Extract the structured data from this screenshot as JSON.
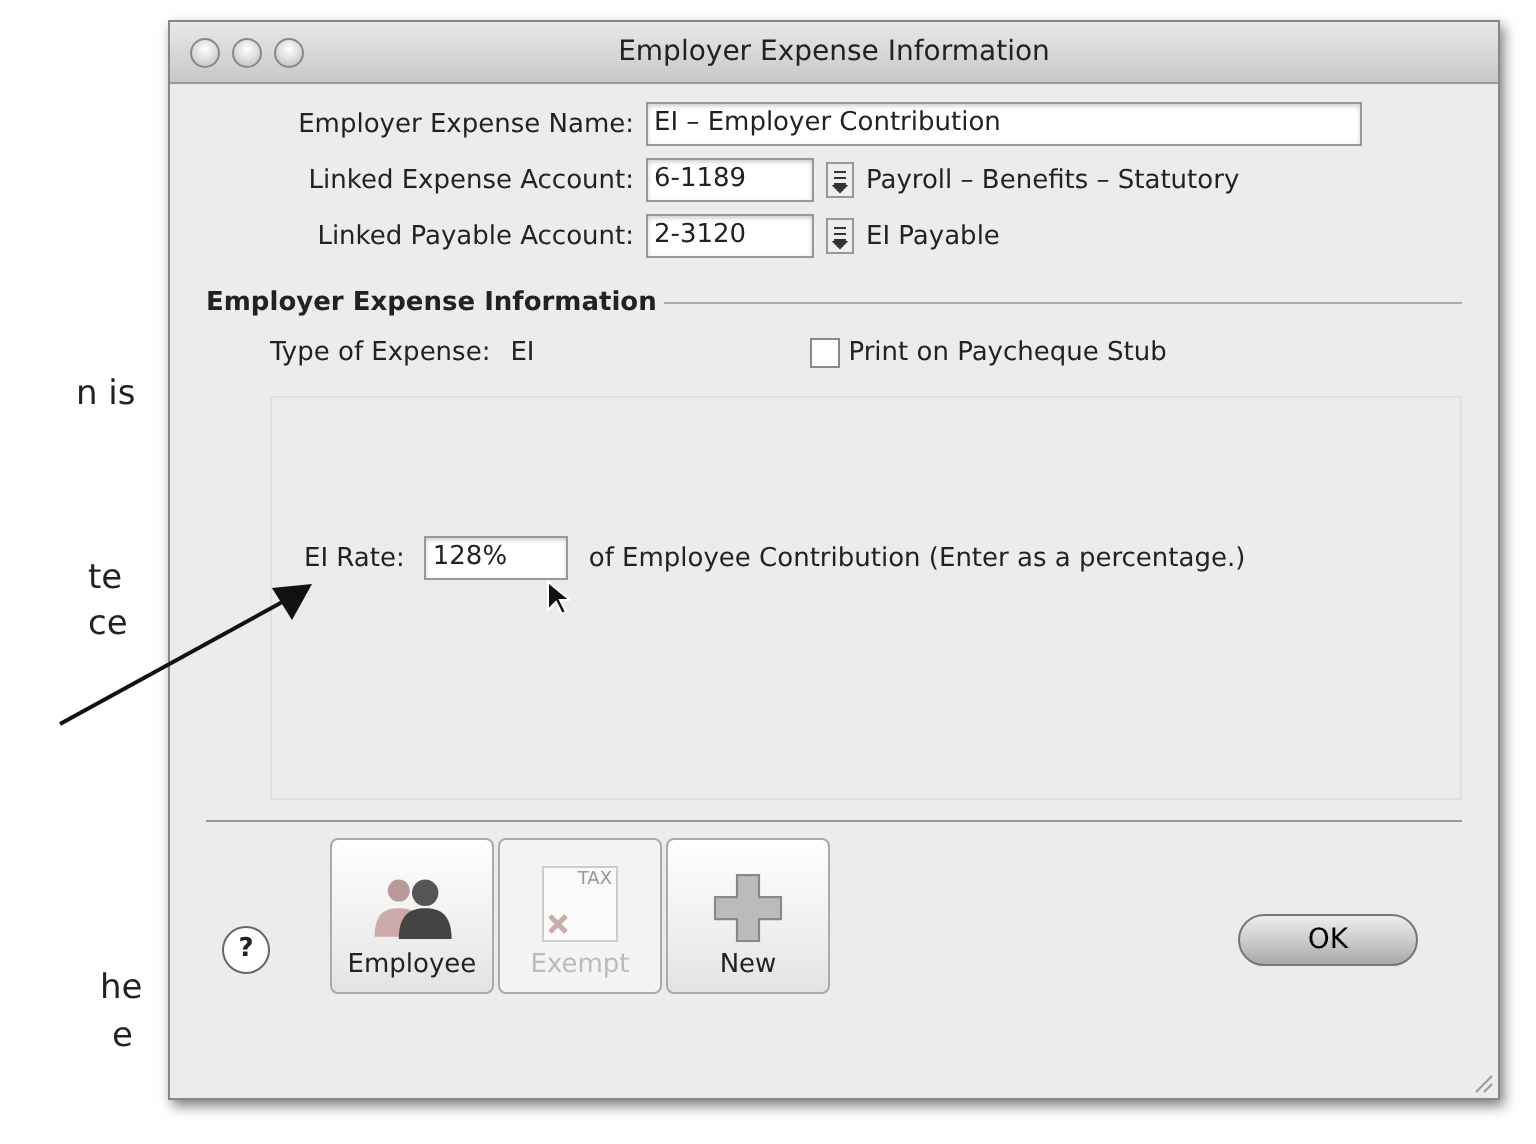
{
  "margin_text": [
    "n is",
    "te",
    "ce",
    "he",
    "e"
  ],
  "window": {
    "title": "Employer Expense Information"
  },
  "fields": [
    {
      "label": "Employer Expense Name:",
      "value": "EI – Employer Contribution",
      "kind": "text"
    },
    {
      "label": "Linked Expense Account:",
      "value": "6-1189",
      "kind": "account",
      "account_name": "Payroll – Benefits – Statutory"
    },
    {
      "label": "Linked Payable Account:",
      "value": "2-3120",
      "kind": "account",
      "account_name": "EI Payable"
    }
  ],
  "section": {
    "title": "Employer Expense Information",
    "type_label": "Type of Expense:",
    "type_value": "EI",
    "checkbox": {
      "label": "Print on Paycheque Stub",
      "checked": false
    },
    "rate_label": "EI Rate:",
    "rate_value": "128%",
    "rate_suffix": "of Employee Contribution (Enter as a percentage.)"
  },
  "toolbar": [
    {
      "label": "Employee",
      "kind": "people",
      "disabled": false
    },
    {
      "label": "Exempt",
      "kind": "tax",
      "disabled": true,
      "icon_text": "TAX"
    },
    {
      "label": "New",
      "kind": "plus",
      "disabled": false
    }
  ],
  "help": "?",
  "ok_button": "OK"
}
